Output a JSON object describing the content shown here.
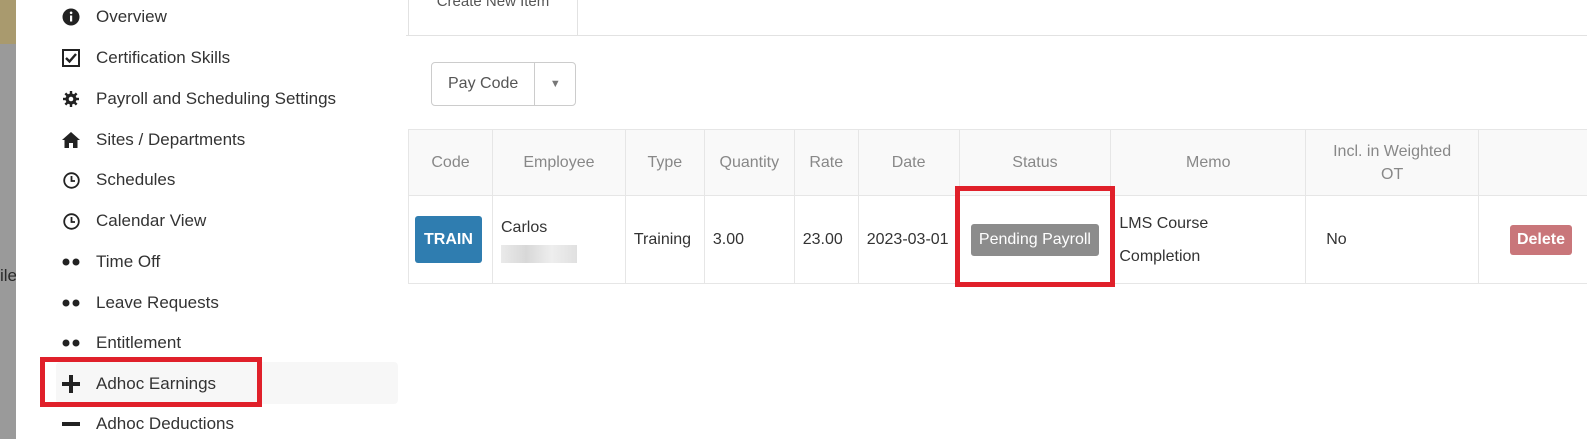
{
  "left_peek_text": "ile",
  "sidebar": {
    "items": [
      {
        "label": "Overview",
        "icon": "info-circle-icon"
      },
      {
        "label": "Certification Skills",
        "icon": "checkbox-icon"
      },
      {
        "label": "Payroll and Scheduling Settings",
        "icon": "gear-icon"
      },
      {
        "label": "Sites / Departments",
        "icon": "home-icon"
      },
      {
        "label": "Schedules",
        "icon": "clock-icon"
      },
      {
        "label": "Calendar View",
        "icon": "clock-icon"
      },
      {
        "label": "Time Off",
        "icon": "dots-icon"
      },
      {
        "label": "Leave Requests",
        "icon": "dots-icon"
      },
      {
        "label": "Entitlement",
        "icon": "dots-icon"
      },
      {
        "label": "Adhoc Earnings",
        "icon": "plus-icon"
      },
      {
        "label": "Adhoc Deductions",
        "icon": "minus-icon"
      }
    ]
  },
  "main": {
    "tab_create": "Create New Item",
    "paycode_label": "Pay Code",
    "table": {
      "headers": [
        "Code",
        "Employee",
        "Type",
        "Quantity",
        "Rate",
        "Date",
        "Status",
        "Memo",
        "Incl. in Weighted OT",
        ""
      ],
      "rows": [
        {
          "code": "TRAIN",
          "employee": "Carlos",
          "type": "Training",
          "quantity": "3.00",
          "rate": "23.00",
          "date": "2023-03-01",
          "status": "Pending Payroll",
          "memo": "LMS Course Completion",
          "weighted_ot": "No",
          "action": "Delete"
        }
      ]
    }
  },
  "colors": {
    "highlight": "#e0202a",
    "train_badge": "#2f7db0",
    "status_badge": "#8c8c8c",
    "delete_button": "#c9767a"
  }
}
